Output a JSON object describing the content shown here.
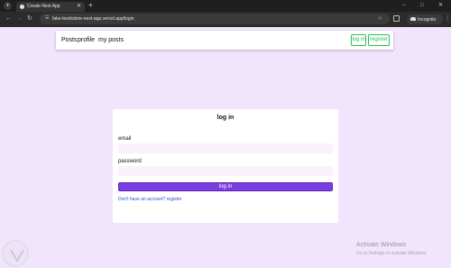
{
  "browser": {
    "tab_title": "Create Next App",
    "url": "fake-bookstore-next-app.vercel.app/login",
    "incognito_label": "Incognito",
    "icons": [
      "tab-search-icon",
      "close-icon",
      "plus-icon",
      "back-arrow-icon",
      "forward-arrow-icon",
      "reload-icon",
      "site-info-icon",
      "star-icon",
      "extensions-icon",
      "incognito-icon",
      "kebab-menu-icon"
    ]
  },
  "navbar": {
    "links": [
      "Posts",
      "profile",
      "my posts"
    ],
    "login_label": "log in",
    "register_label": "register",
    "accent_color": "#2bbf5a"
  },
  "login_form": {
    "title": "log in",
    "email_label": "email",
    "email_value": "",
    "password_label": "password",
    "password_value": "",
    "submit_label": "log in",
    "register_prompt": "Don't have an account? register",
    "button_color": "#7a3ee0"
  },
  "watermark": {
    "title": "Activate Windows",
    "subtitle": "Go to Settings to activate Windows."
  }
}
